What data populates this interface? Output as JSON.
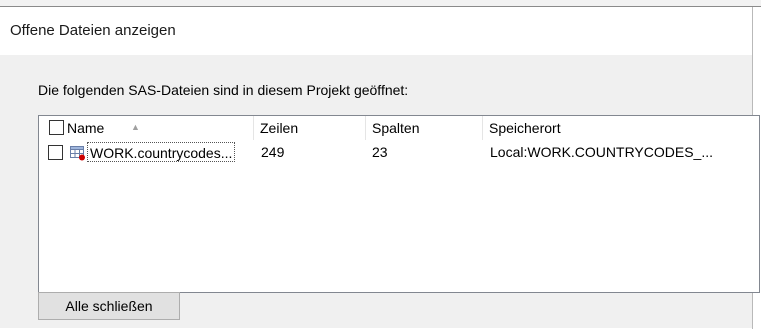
{
  "window": {
    "title": "Offene Dateien anzeigen"
  },
  "intro_text": "Die folgenden SAS-Dateien sind in diesem Projekt geöffnet:",
  "table": {
    "columns": [
      "Name",
      "Zeilen",
      "Spalten",
      "Speicherort"
    ],
    "sort_indicator": "▲",
    "rows": [
      {
        "name": "WORK.countrycodes...",
        "rows": "249",
        "cols": "23",
        "location": "Local:WORK.COUNTRYCODES_...",
        "checked": false
      }
    ]
  },
  "buttons": {
    "close_all": "Alle schließen"
  },
  "icons": {
    "sort": "sort-ascending-icon",
    "row": "sas-table-icon"
  },
  "colors": {
    "dialog_bg": "#f0f0f0",
    "button_bg": "#e1e1e1",
    "icon_red": "#cc0000"
  }
}
